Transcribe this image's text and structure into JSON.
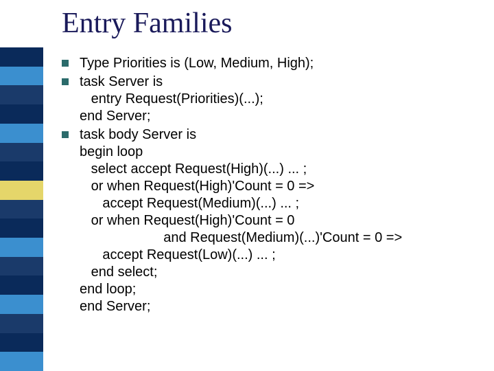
{
  "title": "Entry Families",
  "sidebar_colors": [
    "#0a2a5a",
    "#3b8fcf",
    "#1a3a6a",
    "#0a2a5a",
    "#3b8fcf",
    "#1a3a6a",
    "#0a2a5a",
    "#e5d66a",
    "#1a3a6a",
    "#0a2a5a",
    "#3b8fcf",
    "#1a3a6a",
    "#0a2a5a",
    "#3b8fcf",
    "#1a3a6a",
    "#0a2a5a",
    "#3b8fcf"
  ],
  "bullets": [
    {
      "text": "Type Priorities is (Low, Medium, High);"
    },
    {
      "text": "task Server is\n   entry Request(Priorities)(...);\nend Server;"
    },
    {
      "text": "task body Server is\nbegin loop\n   select accept Request(High)(...) ... ;\n   or when Request(High)'Count = 0 =>\n      accept Request(Medium)(...) ... ;\n   or when Request(High)'Count = 0\n                      and Request(Medium)(...)'Count = 0 =>\n      accept Request(Low)(...) ... ;\n   end select;\nend loop;\nend Server;"
    }
  ]
}
